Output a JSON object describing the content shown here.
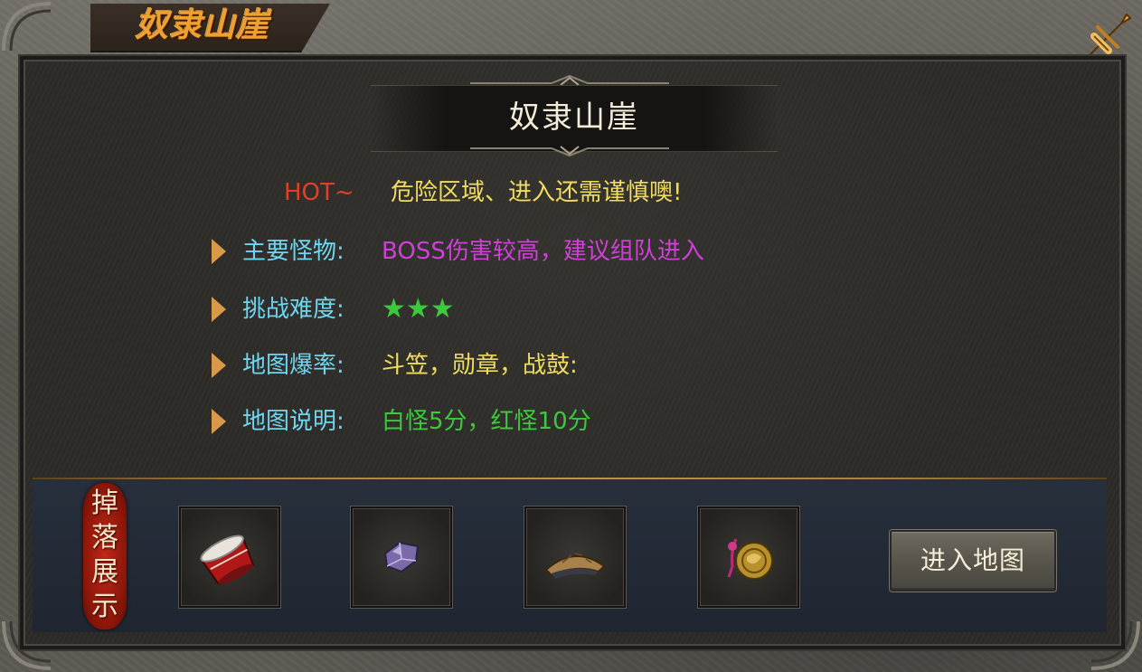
{
  "window": {
    "title": "奴隶山崖"
  },
  "heading": "奴隶山崖",
  "hot": {
    "tag": "HOT~",
    "message": "危险区域、进入还需谨慎噢!"
  },
  "info": [
    {
      "label": "主要怪物:",
      "value": "BOSS伤害较高，建议组队进入",
      "value_color": "#d040d8"
    },
    {
      "label": "挑战难度:",
      "value": "★★★",
      "value_color": "#3ec83e"
    },
    {
      "label": "地图爆率:",
      "value": "斗笠，勋章，战鼓:",
      "value_color": "#f0dc60"
    },
    {
      "label": "地图说明:",
      "value": "白怪5分，红怪10分",
      "value_color": "#3ec83e"
    }
  ],
  "difficulty_stars": 3,
  "drops": {
    "tag_chars": [
      "掉",
      "落",
      "展",
      "示"
    ],
    "items": [
      {
        "icon": "war-drum-icon"
      },
      {
        "icon": "purple-gem-icon"
      },
      {
        "icon": "straw-hat-icon"
      },
      {
        "icon": "gold-medal-icon"
      }
    ]
  },
  "enter_button": "进入地图",
  "colors": {
    "title_gold": "#f0a030",
    "label_cyan": "#6fd6f0",
    "hot_red": "#e0402a",
    "message_yellow": "#f0dc60",
    "divider_gold": "#c89040",
    "drop_tag_red": "#c0281a"
  }
}
